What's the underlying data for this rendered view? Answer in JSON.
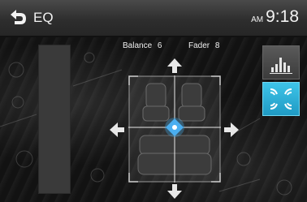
{
  "header": {
    "back_icon": "back-arrow-icon",
    "title": "EQ",
    "clock_ampm": "AM",
    "clock_time": "9:18"
  },
  "readouts": {
    "balance_label": "Balance",
    "balance_value": "6",
    "fader_label": "Fader",
    "fader_value": "8"
  },
  "controls": {
    "up_icon": "arrow-up-icon",
    "down_icon": "arrow-down-icon",
    "left_icon": "arrow-left-icon",
    "right_icon": "arrow-right-icon"
  },
  "sidebar": {
    "eq_button_icon": "equalizer-bars-icon",
    "sound_button_icon": "speaker-waves-icon",
    "active_color": "#2fb3dc"
  }
}
